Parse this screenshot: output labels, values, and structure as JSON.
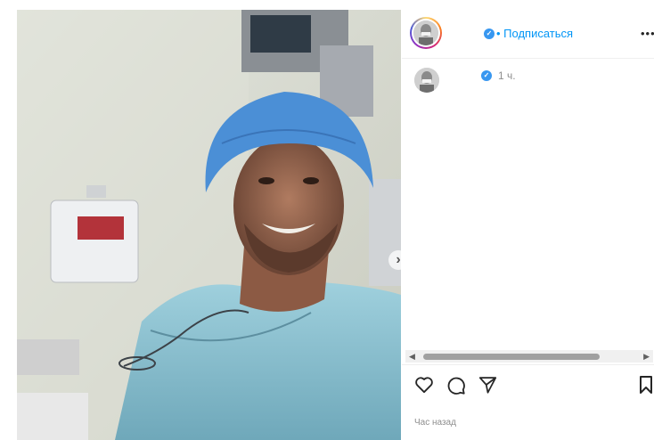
{
  "post": {
    "follow_label": "• Подписаться",
    "more_label": "•••",
    "comment_time": "1 ч.",
    "time_ago": "Час назад",
    "next_arrow": "›"
  },
  "icons": [
    "verified-badge-icon",
    "chevron-right-icon",
    "heart-icon",
    "comment-icon",
    "share-icon",
    "bookmark-icon",
    "scroll-left-icon",
    "scroll-right-icon"
  ],
  "colors": {
    "link": "#0095f6",
    "verified": "#3897f0",
    "muted": "#8e8e8e"
  }
}
